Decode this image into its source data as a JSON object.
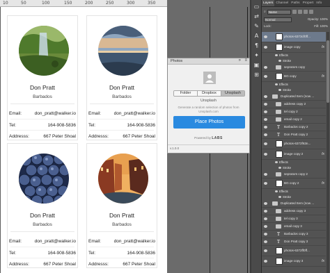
{
  "ruler": {
    "ticks": [
      "10",
      "50",
      "100",
      "150",
      "200",
      "250",
      "300",
      "350"
    ]
  },
  "cards": [
    {
      "name": "Don Pratt",
      "country": "Barbados",
      "email_label": "Email:",
      "email": "don_pratt@walker.io",
      "tel_label": "Tel:",
      "tel": "164-908-5836",
      "address_label": "Addresss:",
      "address": "667 Peter Shoal",
      "photo": "forest-waterfall"
    },
    {
      "name": "Don Pratt",
      "country": "Barbados",
      "email_label": "Email:",
      "email": "don_pratt@walker.io",
      "tel_label": "Tel:",
      "tel": "164-908-5836",
      "address_label": "Addresss:",
      "address": "667 Peter Shoal",
      "photo": "sunset-sea"
    },
    {
      "name": "Don Pratt",
      "country": "Barbados",
      "email_label": "Email:",
      "email": "don_pratt@walker.io",
      "tel_label": "Tel:",
      "tel": "164-908-5836",
      "address_label": "Addresss:",
      "address": "667 Peter Shoal",
      "photo": "blueberries"
    },
    {
      "name": "Don Pratt",
      "country": "Barbados",
      "email_label": "Email:",
      "email": "don_pratt@walker.io",
      "tel_label": "Tel:",
      "tel": "164-908-5836",
      "address_label": "Addresss:",
      "address": "667 Peter Shoal",
      "photo": "canal-city"
    }
  ],
  "photos_panel": {
    "title": "Photos",
    "menu_icon": "≡",
    "close_icon": "»",
    "tabs": [
      "Folder",
      "Dropbox",
      "Unsplash"
    ],
    "active_tab": "Unsplash",
    "source_label": "Unsplash",
    "description": "Generate a random selection of photos from Unsplash.com",
    "button": "Place Photos",
    "powered_by": "Powered by",
    "brand": "LABS",
    "version": "v.1.0.0"
  },
  "tools": [
    "▭",
    "⇄",
    "✎",
    "A",
    "¶",
    "✦",
    "▣",
    "⊞"
  ],
  "layers_panel": {
    "tabs": [
      "Layers",
      "Channel",
      "Paths",
      "Propert",
      "Info"
    ],
    "active_tab": "Layers",
    "filter_kind": "Name",
    "blend_mode": "Normal",
    "opacity_label": "Opacity:",
    "opacity": "100%",
    "lock_label": "Lock:",
    "fill_label": "Fill:",
    "fill": "100%",
    "layers": [
      {
        "name": "photos-6373cf0ff...",
        "kind": "thumb",
        "indent": 2,
        "fx": false,
        "selected": true
      },
      {
        "name": "image copy",
        "kind": "thumb",
        "indent": 2,
        "fx": true
      },
      {
        "name": "Effects",
        "kind": "sub",
        "indent": 3
      },
      {
        "name": "Stroke",
        "kind": "sub",
        "indent": 4
      },
      {
        "name": "seprators copy",
        "kind": "folder",
        "indent": 2,
        "fx": false
      },
      {
        "name": "BG copy",
        "kind": "thumb",
        "indent": 2,
        "fx": true
      },
      {
        "name": "Effects",
        "kind": "sub",
        "indent": 3
      },
      {
        "name": "Stroke",
        "kind": "sub",
        "indent": 4
      },
      {
        "name": "Duplicated Item (now ...",
        "kind": "folder",
        "indent": 1,
        "fx": false
      },
      {
        "name": "address copy 2",
        "kind": "folder",
        "indent": 2,
        "fx": false
      },
      {
        "name": "tel copy 2",
        "kind": "folder",
        "indent": 2,
        "fx": false
      },
      {
        "name": "email copy 2",
        "kind": "folder",
        "indent": 2,
        "fx": false
      },
      {
        "name": "Barbados copy 2",
        "kind": "text",
        "indent": 2,
        "fx": false
      },
      {
        "name": "Don Pratt copy 2",
        "kind": "text",
        "indent": 2,
        "fx": false
      },
      {
        "name": "photos-6372f63n...",
        "kind": "thumb",
        "indent": 2,
        "fx": false
      },
      {
        "name": "image copy 2",
        "kind": "thumb",
        "indent": 2,
        "fx": true
      },
      {
        "name": "Effects",
        "kind": "sub",
        "indent": 3
      },
      {
        "name": "Stroke",
        "kind": "sub",
        "indent": 4
      },
      {
        "name": "seprators copy 2",
        "kind": "folder",
        "indent": 2,
        "fx": false
      },
      {
        "name": "BG copy 2",
        "kind": "thumb",
        "indent": 2,
        "fx": true
      },
      {
        "name": "Effects",
        "kind": "sub",
        "indent": 3
      },
      {
        "name": "Stroke",
        "kind": "sub",
        "indent": 4
      },
      {
        "name": "Duplicated Item (now ...",
        "kind": "folder",
        "indent": 1,
        "fx": false
      },
      {
        "name": "address copy 3",
        "kind": "folder",
        "indent": 2,
        "fx": false
      },
      {
        "name": "tel copy 3",
        "kind": "folder",
        "indent": 2,
        "fx": false
      },
      {
        "name": "email copy 3",
        "kind": "folder",
        "indent": 2,
        "fx": false
      },
      {
        "name": "Barbados copy 3",
        "kind": "text",
        "indent": 2,
        "fx": false
      },
      {
        "name": "Don Pratt copy 3",
        "kind": "text",
        "indent": 2,
        "fx": false
      },
      {
        "name": "photos-6372ff0ff...",
        "kind": "thumb",
        "indent": 2,
        "fx": false
      },
      {
        "name": "image copy 3",
        "kind": "thumb",
        "indent": 2,
        "fx": true
      }
    ]
  },
  "colors": {
    "accent": "#2a8ae0",
    "selected_layer": "#6d7a8c"
  }
}
